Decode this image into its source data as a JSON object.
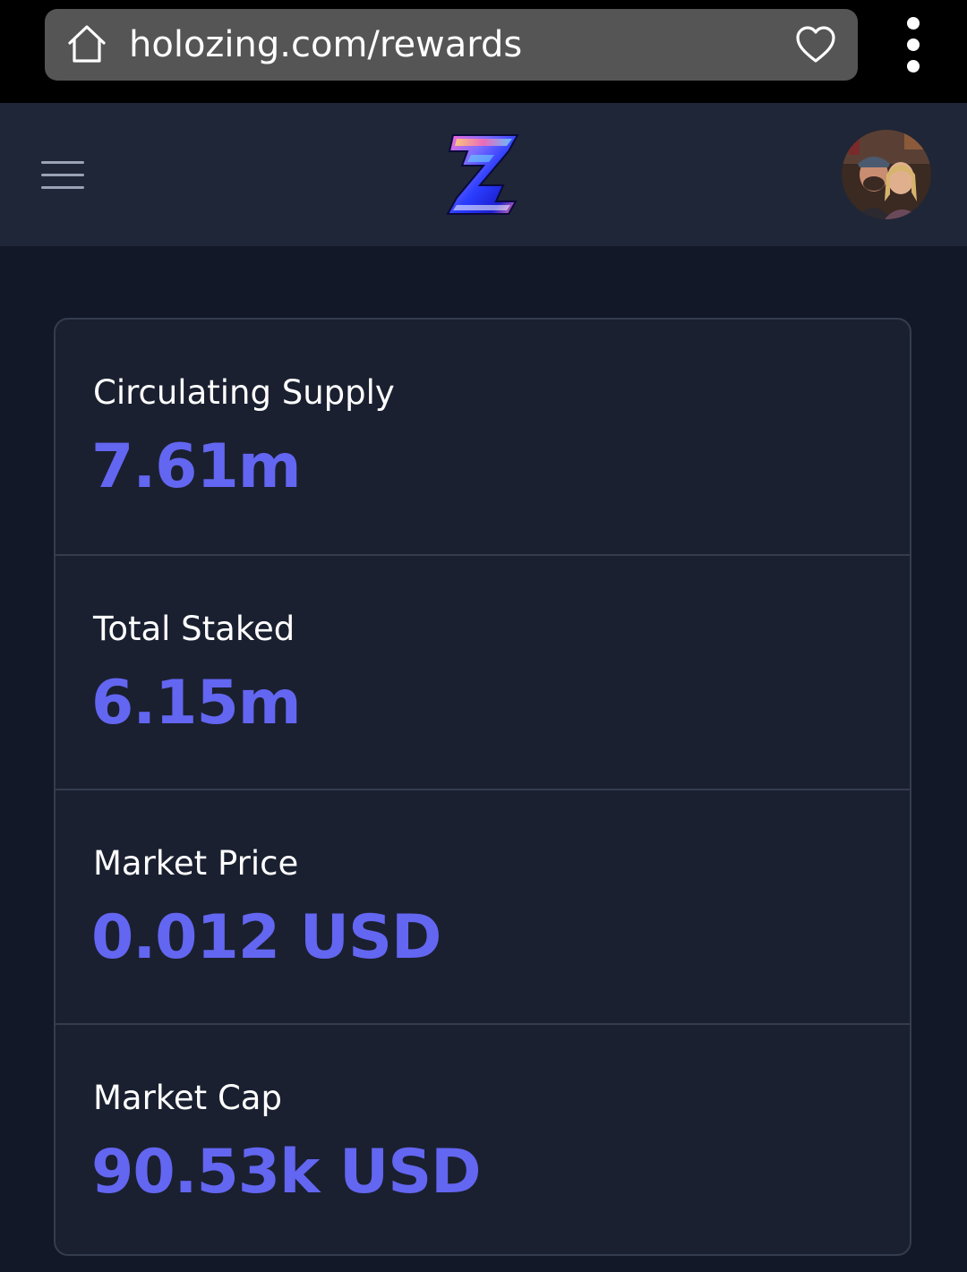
{
  "browser": {
    "url": "holozing.com/rewards",
    "home_icon": "home-icon",
    "favorite_icon": "heart-icon",
    "menu_icon": "more-vertical-icon"
  },
  "header": {
    "menu_icon": "hamburger-icon",
    "logo": "holozing-z-logo",
    "avatar": "user-avatar"
  },
  "stats": [
    {
      "label": "Circulating Supply",
      "value": "7.61m"
    },
    {
      "label": "Total Staked",
      "value": "6.15m"
    },
    {
      "label": "Market Price",
      "value": "0.012 USD"
    },
    {
      "label": "Market Cap",
      "value": "90.53k USD"
    }
  ],
  "colors": {
    "background": "#121827",
    "header": "#1f2637",
    "card": "#1a2030",
    "accent": "#6366f1",
    "border": "#343c4e"
  }
}
